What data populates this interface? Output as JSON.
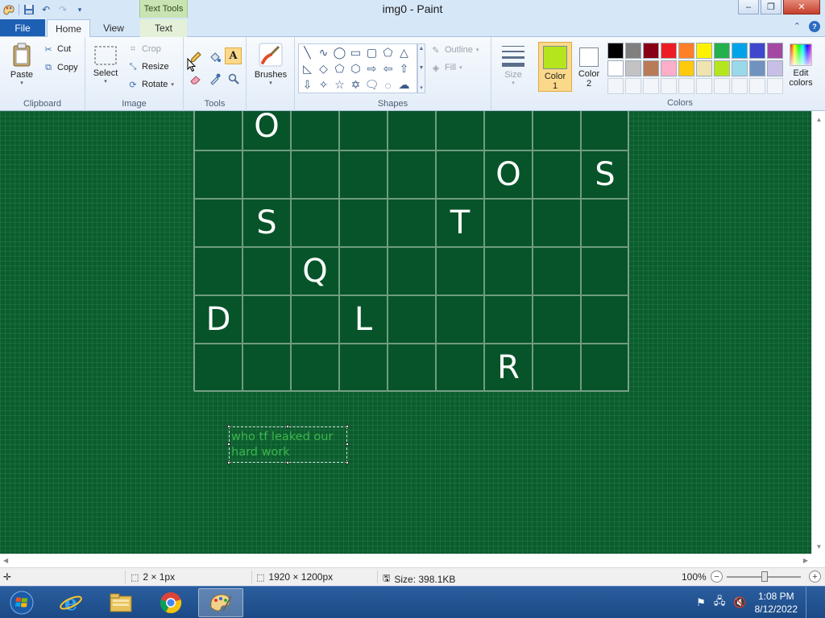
{
  "window": {
    "title": "img0 - Paint",
    "context_tab_header": "Text Tools",
    "controls": {
      "minimize": "–",
      "restore": "❐",
      "close": "✕"
    }
  },
  "tabs": {
    "file": "File",
    "home": "Home",
    "view": "View",
    "text": "Text",
    "active": "Home"
  },
  "ribbon": {
    "clipboard": {
      "label": "Clipboard",
      "paste": "Paste",
      "cut": "Cut",
      "copy": "Copy"
    },
    "image": {
      "label": "Image",
      "select": "Select",
      "crop": "Crop",
      "resize": "Resize",
      "rotate": "Rotate"
    },
    "tools": {
      "label": "Tools"
    },
    "brushes": {
      "label": "Brushes"
    },
    "shapes": {
      "label": "Shapes",
      "outline": "Outline",
      "fill": "Fill"
    },
    "size": {
      "label": "Size"
    },
    "colors": {
      "label": "Colors",
      "color1_label": "Color",
      "color1_num": "1",
      "color2_label": "Color",
      "color2_num": "2",
      "edit": "Edit",
      "edit2": "colors",
      "color1_value": "#b5e61d",
      "color2_value": "#ffffff",
      "palette_row1": [
        "#000000",
        "#7f7f7f",
        "#880015",
        "#ed1c24",
        "#ff7f27",
        "#fff200",
        "#22b14c",
        "#00a2e8",
        "#3f48cc",
        "#a349a4"
      ],
      "palette_row2": [
        "#ffffff",
        "#c3c3c3",
        "#b97a57",
        "#ffaec9",
        "#ffc90e",
        "#efe4b0",
        "#b5e61d",
        "#99d9ea",
        "#7092be",
        "#c8bfe7"
      ]
    }
  },
  "canvas": {
    "background": "#0a5e2d",
    "grid_rows": [
      [
        "",
        "O",
        "",
        "",
        "",
        "",
        "",
        "",
        ""
      ],
      [
        "",
        "",
        "",
        "",
        "",
        "",
        "O",
        "",
        "S"
      ],
      [
        "",
        "S",
        "",
        "",
        "",
        "T",
        "",
        "",
        ""
      ],
      [
        "",
        "",
        "Q",
        "",
        "",
        "",
        "",
        "",
        ""
      ],
      [
        "D",
        "",
        "",
        "L",
        "",
        "",
        "",
        "",
        ""
      ],
      [
        "",
        "",
        "",
        "",
        "",
        "",
        "R",
        "",
        ""
      ]
    ],
    "textbox_text": "who tf leaked our hard work",
    "textbox_color": "#3fb44c"
  },
  "statusbar": {
    "selection_size": "2 × 1px",
    "image_size": "1920 × 1200px",
    "file_size": "Size: 398.1KB",
    "zoom": "100%"
  },
  "taskbar": {
    "apps": [
      "Internet Explorer",
      "File Explorer",
      "Google Chrome",
      "Paint"
    ],
    "time": "1:08 PM",
    "date": "8/12/2022"
  }
}
